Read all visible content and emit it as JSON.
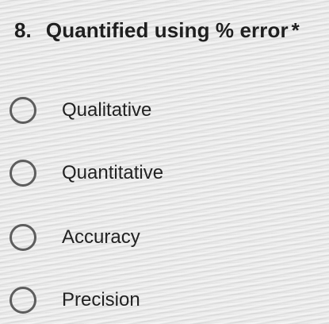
{
  "question": {
    "number": "8.",
    "text": "Quantified using % error",
    "required_marker": "*"
  },
  "options": [
    {
      "label": "Qualitative",
      "selected": false
    },
    {
      "label": "Quantitative",
      "selected": false
    },
    {
      "label": "Accuracy",
      "selected": false
    },
    {
      "label": "Precision",
      "selected": false
    }
  ],
  "colors": {
    "radio_border": "#5d5d5d",
    "text": "#1f1f1f"
  }
}
